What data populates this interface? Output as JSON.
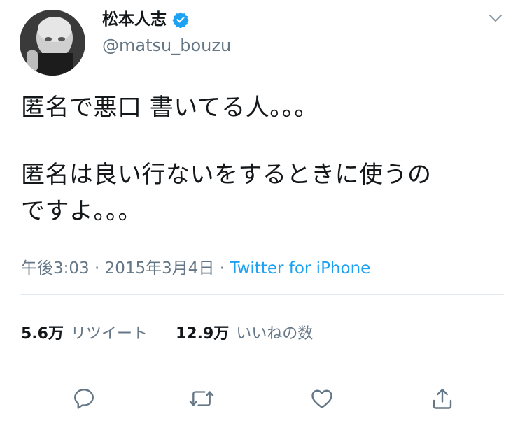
{
  "author": {
    "display_name": "松本人志",
    "handle": "@matsu_bouzu",
    "verified": true,
    "avatar_icon": "profile-photo"
  },
  "tweet": {
    "line1": "匿名で悪口 書いてる人。。。",
    "line2": "匿名は良い行ないをするときに使うの",
    "line3": "ですよ。。。"
  },
  "meta": {
    "time": "午後3:03",
    "sep1": " · ",
    "date": "2015年3月4日",
    "sep2": " · ",
    "source": "Twitter for iPhone"
  },
  "stats": {
    "retweets_count": "5.6万",
    "retweets_label": "リツイート",
    "likes_count": "12.9万",
    "likes_label": "いいねの数"
  },
  "actions": [
    "reply-icon",
    "retweet-icon",
    "like-icon",
    "share-icon"
  ],
  "colors": {
    "text": "#14171a",
    "secondary": "#657786",
    "link": "#1da1f2",
    "verified": "#1da1f2",
    "divider": "#e1e8ed"
  }
}
